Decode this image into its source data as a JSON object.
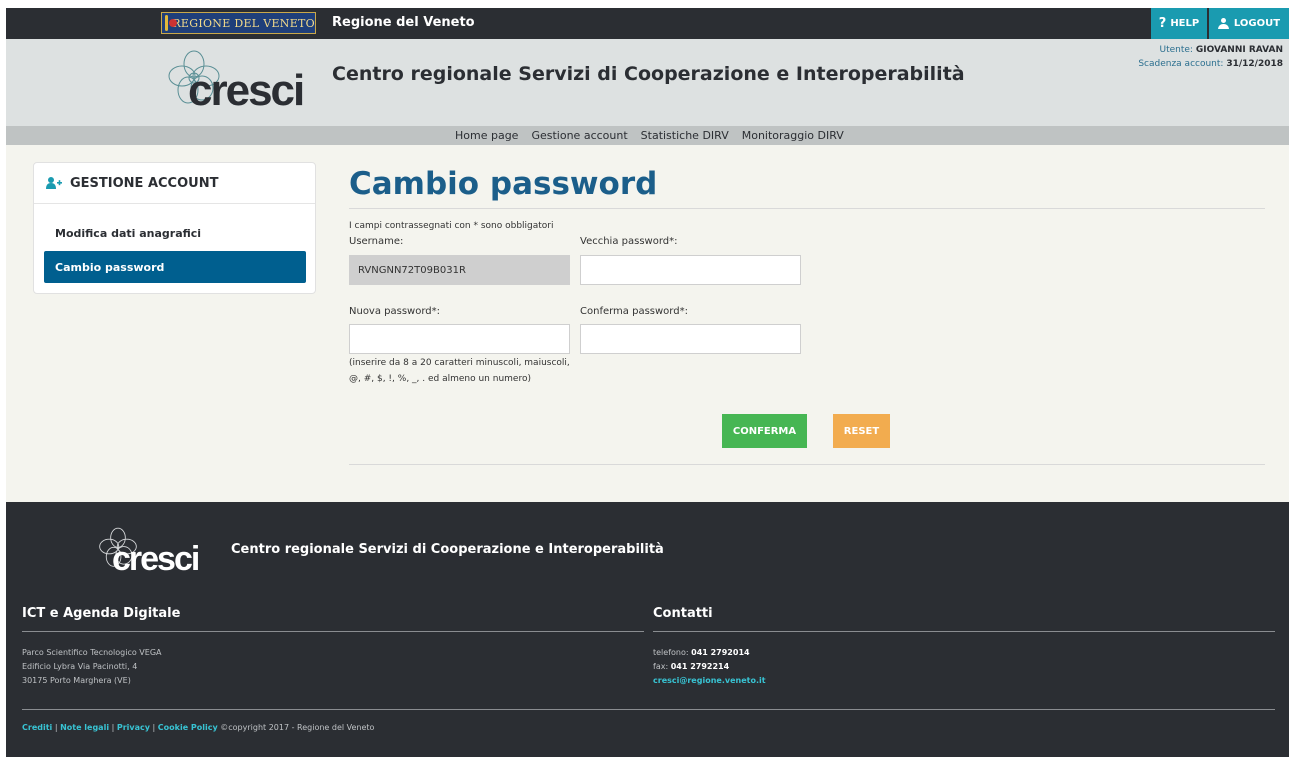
{
  "topbar": {
    "region_logo_text": "REGIONE DEL VENETO",
    "title": "Regione del Veneto",
    "help_label": "HELP",
    "logout_label": "LOGOUT"
  },
  "header": {
    "logo_word": "cresci",
    "title": "Centro regionale Servizi di Cooperazione e Interoperabilità",
    "user_label": "Utente:",
    "user_name": "GIOVANNI RAVAN",
    "expiry_label": "Scadenza account:",
    "expiry_date": "31/12/2018"
  },
  "nav": {
    "items": [
      "Home page",
      "Gestione account",
      "Statistiche DIRV",
      "Monitoraggio DIRV"
    ]
  },
  "sidebar": {
    "heading": "GESTIONE ACCOUNT",
    "items": [
      {
        "label": "Modifica dati anagrafici",
        "active": false
      },
      {
        "label": "Cambio password",
        "active": true
      }
    ]
  },
  "form": {
    "title": "Cambio password",
    "required_note": "I campi contrassegnati con * sono obbligatori",
    "username_label": "Username:",
    "username_value": "RVNGNN72T09B031R",
    "old_password_label": "Vecchia password*:",
    "new_password_label": "Nuova password*:",
    "confirm_password_label": "Conferma password*:",
    "hint_line1": "(inserire da 8 a 20 caratteri minuscoli, maiuscoli,",
    "hint_line2": "@, #, $, !, %, _, . ed almeno un numero)",
    "confirm_button": "CONFERMA",
    "reset_button": "RESET"
  },
  "footer": {
    "logo_word": "cresci",
    "title": "Centro regionale Servizi di Cooperazione e Interoperabilità",
    "ict_heading": "ICT e Agenda Digitale",
    "address_lines": [
      "Parco Scientifico Tecnologico VEGA",
      "Edificio Lybra Via Pacinotti, 4",
      "30175 Porto Marghera (VE)"
    ],
    "contacts_heading": "Contatti",
    "phone_label": "telefono:",
    "phone_value": "041 2792014",
    "fax_label": "fax:",
    "fax_value": "041 2792214",
    "email": "cresci@regione.veneto.it",
    "links": [
      "Crediti",
      "Note legali",
      "Privacy",
      "Cookie Policy"
    ],
    "copyright": "©copyright 2017 - Regione del Veneto"
  },
  "colors": {
    "topbar_bg": "#2b2e33",
    "accent_teal": "#1a9bb0",
    "title_blue": "#1b5e8a",
    "active_item_bg": "#005f8f",
    "confirm_green": "#46b653",
    "reset_orange": "#f2ac4f"
  },
  "icons": {
    "help": "question-mark-icon",
    "logout": "user-icon",
    "sidebar_heading": "add-user-icon"
  }
}
